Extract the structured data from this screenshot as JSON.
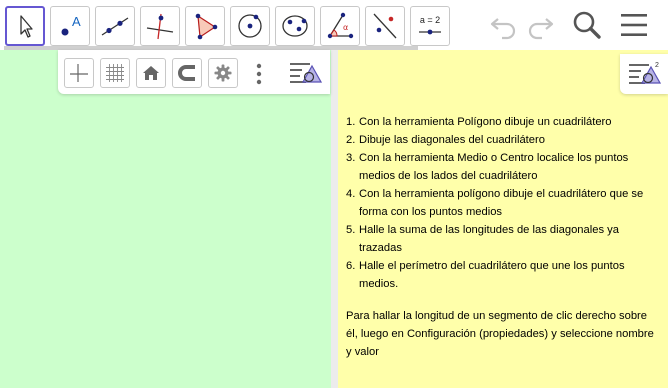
{
  "toolbar": {
    "tools": [
      {
        "name": "move-tool",
        "icon": "cursor-arrow-icon",
        "selected": true
      },
      {
        "name": "point-tool",
        "icon": "point-a-icon",
        "label": "A"
      },
      {
        "name": "line-tool",
        "icon": "line-through-points-icon"
      },
      {
        "name": "perpendicular-tool",
        "icon": "perpendicular-line-icon"
      },
      {
        "name": "polygon-tool",
        "icon": "polygon-icon"
      },
      {
        "name": "circle-tool",
        "icon": "circle-center-point-icon"
      },
      {
        "name": "ellipse-tool",
        "icon": "ellipse-icon"
      },
      {
        "name": "angle-tool",
        "icon": "angle-icon",
        "label": "α"
      },
      {
        "name": "reflect-tool",
        "icon": "reflect-line-icon"
      },
      {
        "name": "slider-tool",
        "icon": "slider-icon",
        "label": "a = 2"
      }
    ],
    "undo_icon": "undo-icon",
    "redo_icon": "redo-icon",
    "search_icon": "search-icon",
    "menu_icon": "hamburger-menu-icon"
  },
  "stylebar": {
    "buttons": [
      "axes-icon",
      "grid-icon",
      "home-icon",
      "magnet-icon",
      "settings-gear-icon"
    ],
    "more_icon": "more-vertical-icon",
    "toggle_icon": "stylebar-toggle-icon"
  },
  "algebra": {
    "toggle_icon": "algebra-stylebar-toggle-icon",
    "toggle_sup": "2",
    "instructions": [
      {
        "num": "1.",
        "text": "Con la herramienta Polígono dibuje un cuadrilátero"
      },
      {
        "num": "2.",
        "text": "Dibuje las diagonales del cuadrilátero"
      },
      {
        "num": "3.",
        "text": "Con la herramienta Medio o Centro localice los puntos medios de los lados del cuadrilátero"
      },
      {
        "num": "4.",
        "text": "Con la herramienta polígono dibuje el cuadrilátero que se forma con los puntos medios"
      },
      {
        "num": "5.",
        "text": "Halle la suma de las longitudes de las diagonales ya trazadas"
      },
      {
        "num": "6.",
        "text": "Halle el perímetro del cuadrilátero que une los puntos medios."
      }
    ],
    "note": "Para hallar la longitud de un segmento de clic derecho sobre él, luego en Configuración (propiedades) y seleccione nombre y valor"
  },
  "colors": {
    "graphics_bg": "#ccffcc",
    "algebra_bg": "#ffffaa",
    "accent": "#6557d2",
    "point_blue": "#1565c0"
  }
}
